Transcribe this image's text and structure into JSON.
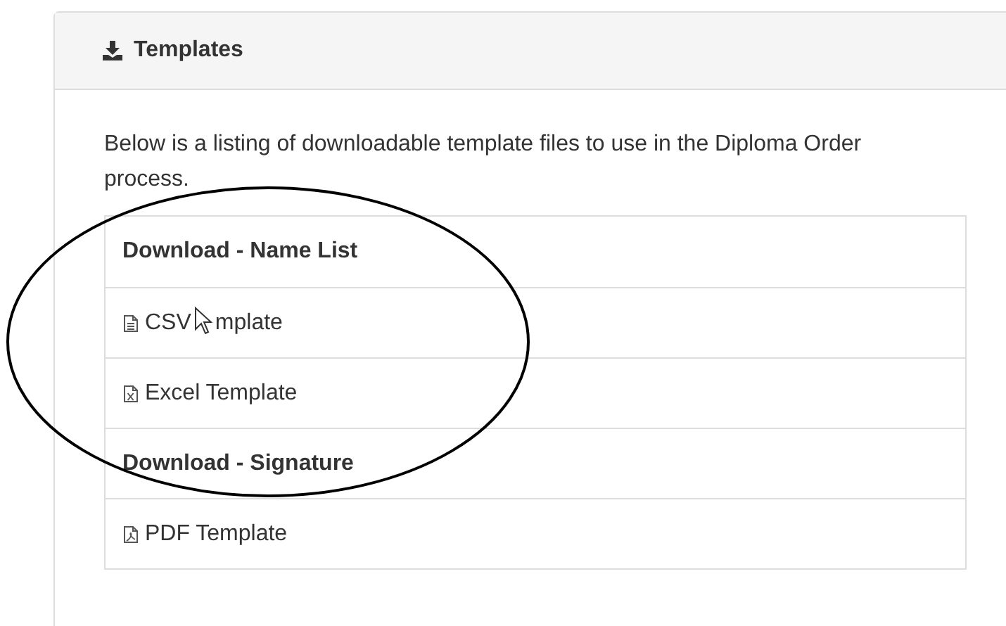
{
  "panel": {
    "title": "Templates"
  },
  "description": "Below is a listing of downloadable template files to use in the Diploma Order process.",
  "rows": [
    {
      "kind": "heading",
      "label": "Download - Name List"
    },
    {
      "kind": "csv",
      "label_parts": [
        "CSV",
        "mplate"
      ],
      "cursor": true
    },
    {
      "kind": "excel",
      "label_parts": [
        "Excel Template"
      ],
      "cursor": false
    },
    {
      "kind": "heading",
      "label": "Download - Signature"
    },
    {
      "kind": "pdf",
      "label_parts": [
        "PDF Template"
      ],
      "cursor": false
    }
  ]
}
